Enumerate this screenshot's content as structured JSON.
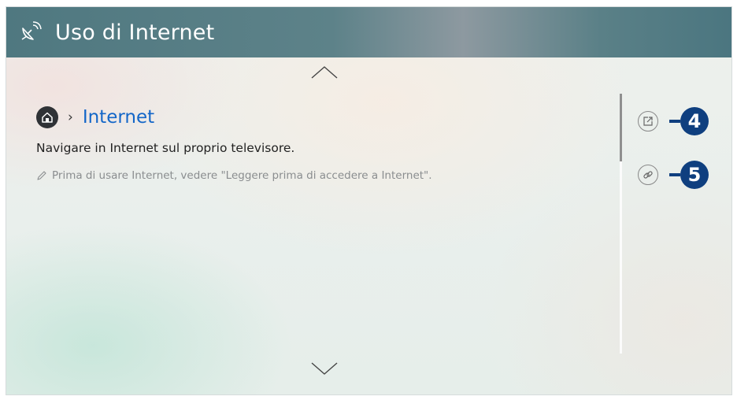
{
  "header": {
    "title": "Uso di Internet",
    "icon": "satellite-dish-icon"
  },
  "breadcrumb": {
    "home_icon": "home-icon",
    "separator": "›",
    "current": "Internet"
  },
  "content": {
    "description": "Navigare in Internet sul proprio televisore.",
    "note": "Prima di usare Internet, vedere \"Leggere prima di accedere a Internet\".",
    "note_icon": "pencil-icon"
  },
  "side_buttons": [
    {
      "icon": "open-external-icon",
      "callout": "4"
    },
    {
      "icon": "link-icon",
      "callout": "5"
    }
  ],
  "colors": {
    "header": "#547c84",
    "link": "#1366c8",
    "callout": "#0f3f7f"
  }
}
